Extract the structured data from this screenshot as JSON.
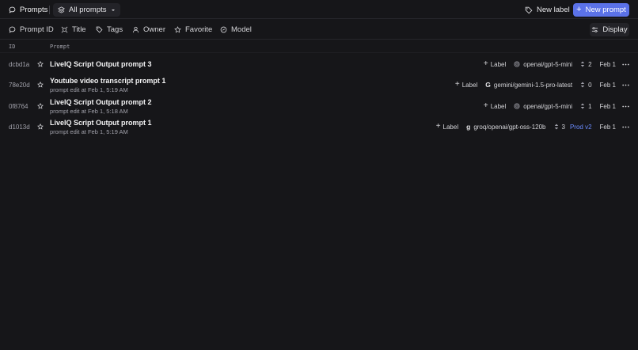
{
  "header": {
    "title": "Prompts",
    "view_select": "All prompts",
    "new_label": "New label",
    "new_prompt": "New prompt",
    "accent": "#5b72e8"
  },
  "filters": [
    {
      "label": "Prompt ID",
      "icon": "message-icon"
    },
    {
      "label": "Title",
      "icon": "title-icon"
    },
    {
      "label": "Tags",
      "icon": "tag-icon"
    },
    {
      "label": "Owner",
      "icon": "user-icon"
    },
    {
      "label": "Favorite",
      "icon": "star-icon"
    },
    {
      "label": "Model",
      "icon": "model-icon"
    }
  ],
  "display_label": "Display",
  "columns": {
    "id": "ID",
    "prompt": "Prompt"
  },
  "rows": [
    {
      "id": "dcbd1a",
      "title": "LiveIQ Script Output prompt 3",
      "subtitle": "",
      "label": "Label",
      "model": "openai/gpt-5-mini",
      "model_icon": "openai-icon",
      "version": "2",
      "env": "",
      "date": "Feb 1"
    },
    {
      "id": "78e20d",
      "title": "Youtube video transcript prompt 1",
      "subtitle": "prompt edit at Feb 1, 5:19 AM",
      "label": "Label",
      "model": "gemini/gemini-1.5-pro-latest",
      "model_icon": "google-icon",
      "version": "0",
      "env": "",
      "date": "Feb 1"
    },
    {
      "id": "0f8764",
      "title": "LiveIQ Script Output prompt 2",
      "subtitle": "prompt edit at Feb 1, 5:18 AM",
      "label": "Label",
      "model": "openai/gpt-5-mini",
      "model_icon": "openai-icon",
      "version": "1",
      "env": "",
      "date": "Feb 1"
    },
    {
      "id": "d1013d",
      "title": "LiveIQ Script Output prompt 1",
      "subtitle": "prompt edit at Feb 1, 5:19 AM",
      "label": "Label",
      "model": "groq/openai/gpt-oss-120b",
      "model_icon": "groq-icon",
      "version": "3",
      "env": "Prod v2",
      "date": "Feb 1"
    }
  ]
}
